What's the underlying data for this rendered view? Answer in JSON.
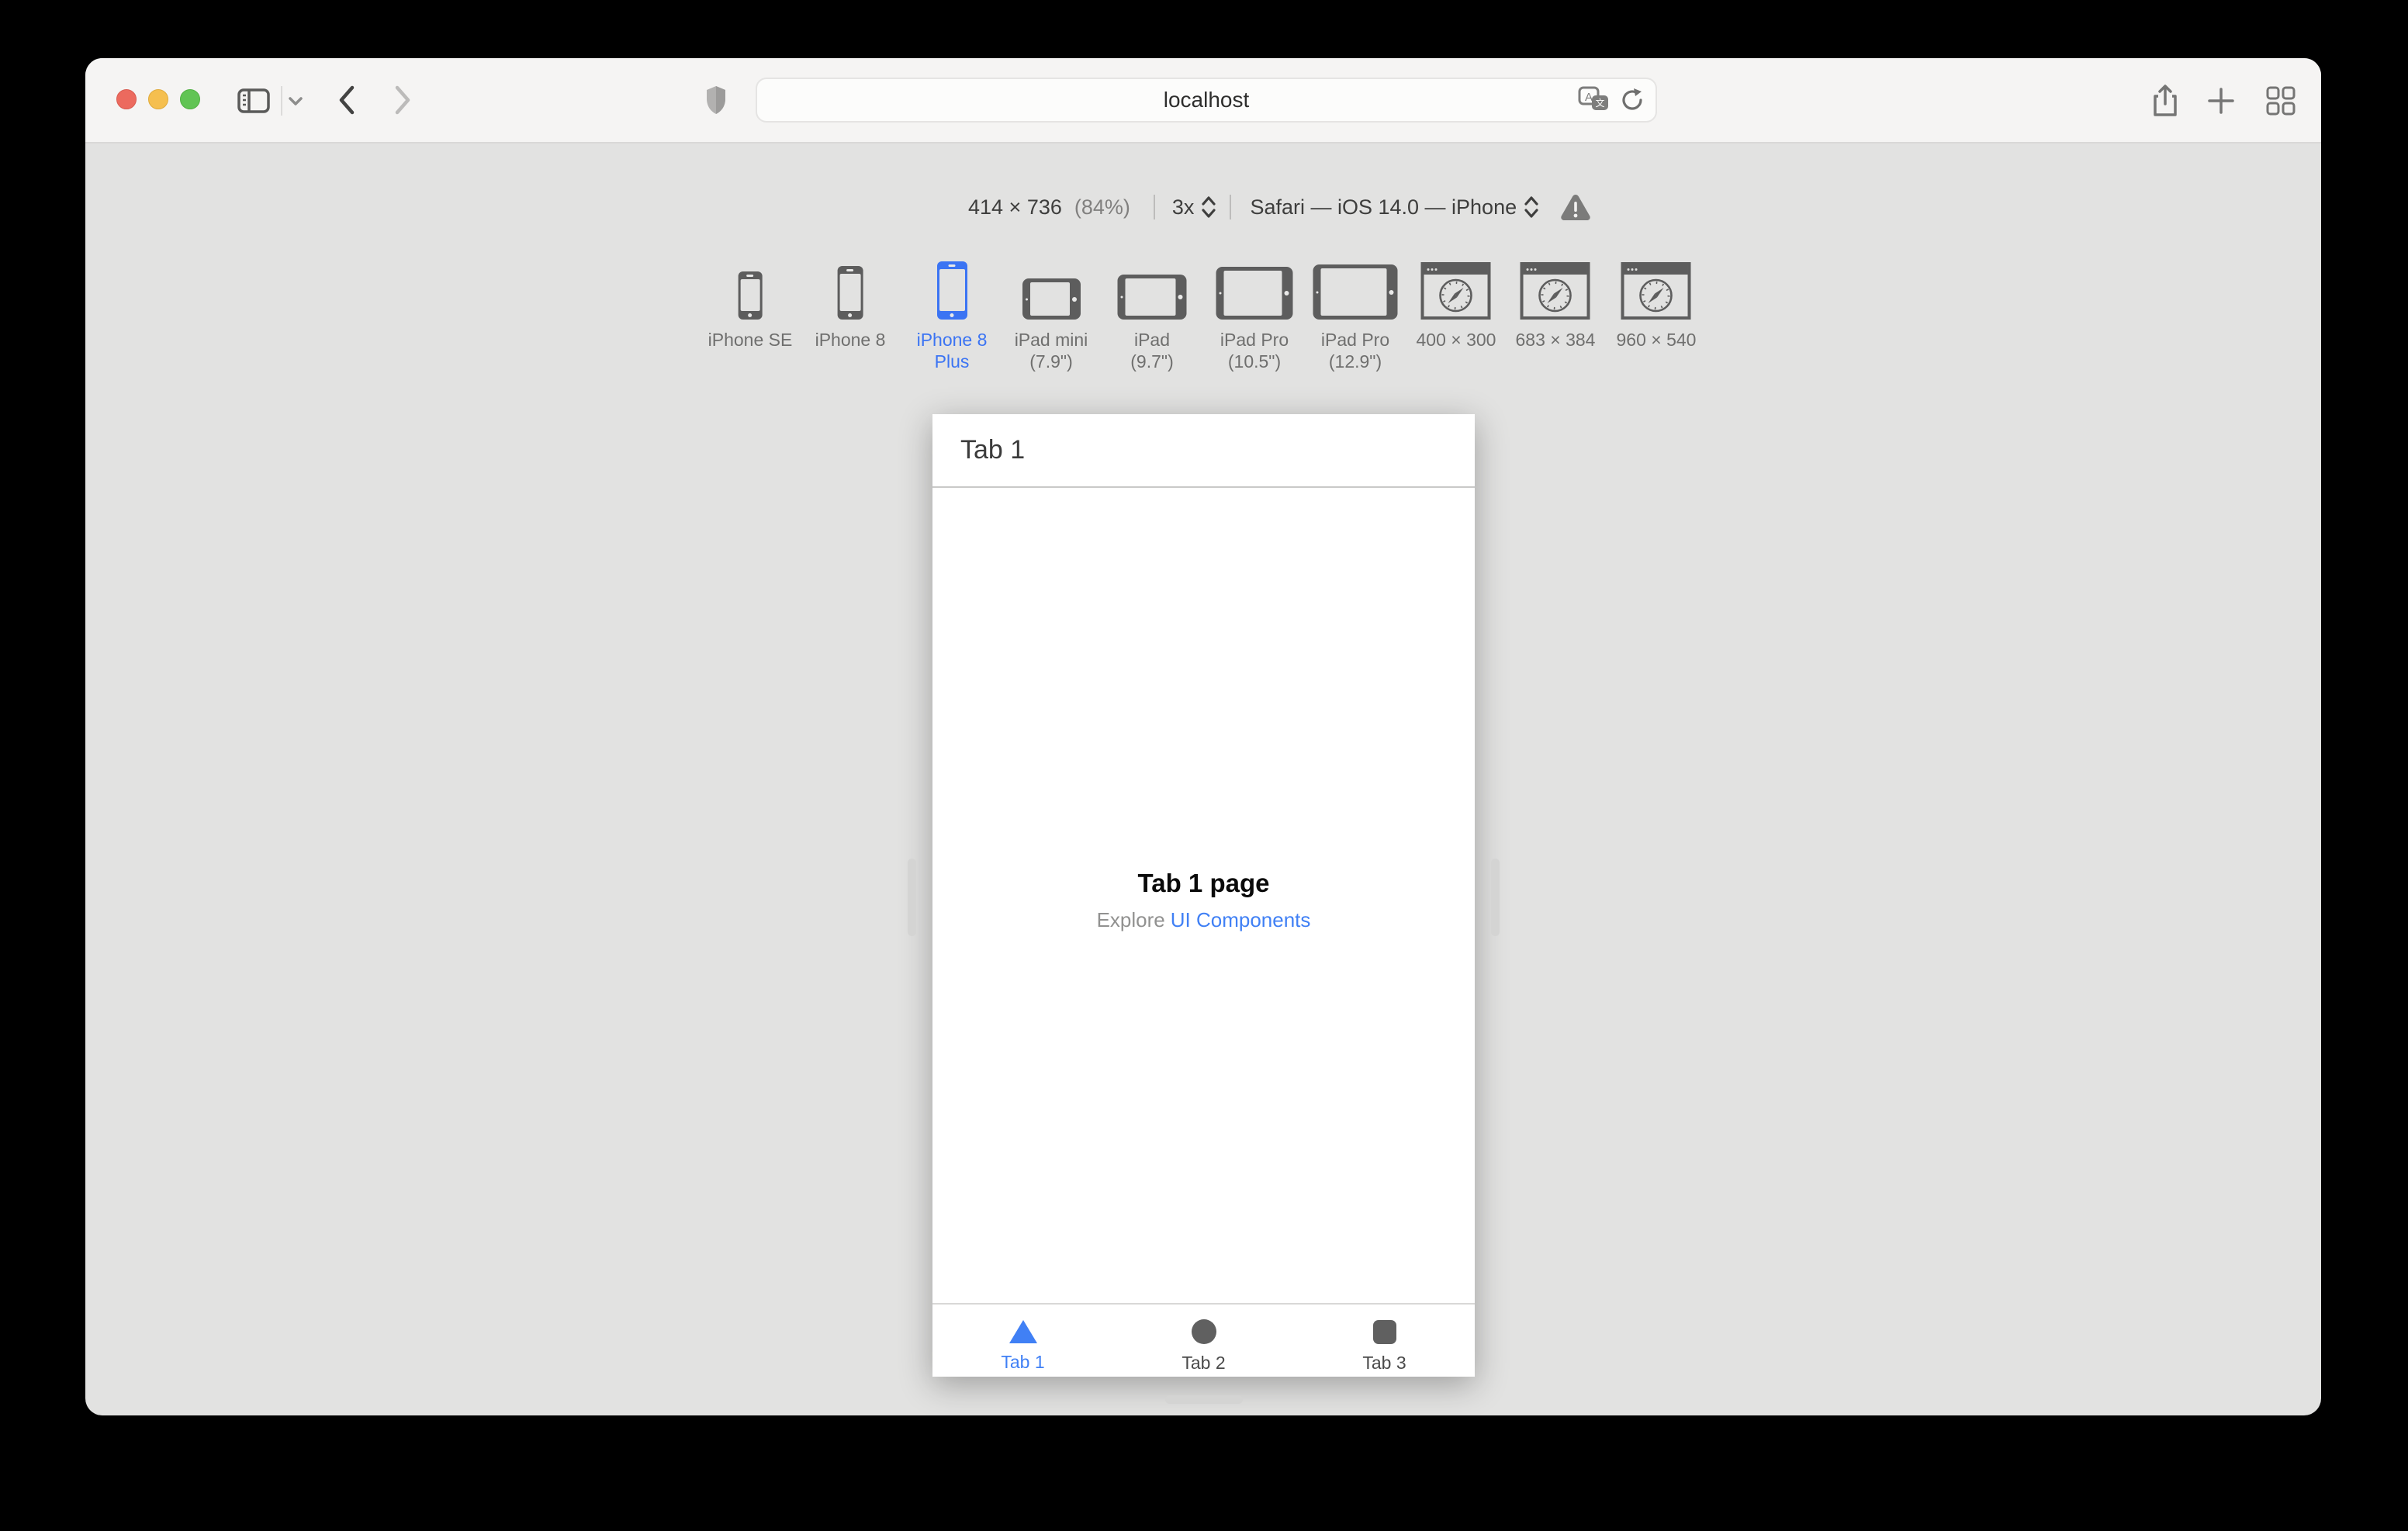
{
  "toolbar": {
    "url": "localhost",
    "icons": [
      "sidebar-icon",
      "chevron-down-icon",
      "back-icon",
      "forward-icon",
      "privacy-shield-icon",
      "translate-icon",
      "reload-icon",
      "share-icon",
      "new-tab-icon",
      "tab-overview-icon"
    ]
  },
  "rdm": {
    "size": "414 × 736",
    "zoom": "(84%)",
    "scale": "3x",
    "user_agent": "Safari — iOS 14.0 — iPhone",
    "devices": [
      {
        "label": "iPhone SE",
        "type": "phone",
        "selected": false
      },
      {
        "label": "iPhone 8",
        "type": "phone",
        "selected": false
      },
      {
        "label": "iPhone 8 Plus",
        "type": "phone",
        "selected": true
      },
      {
        "label": "iPad mini (7.9\")",
        "type": "tablet",
        "selected": false
      },
      {
        "label": "iPad (9.7\")",
        "type": "tablet",
        "selected": false
      },
      {
        "label": "iPad Pro (10.5\")",
        "type": "tablet",
        "selected": false
      },
      {
        "label": "iPad Pro (12.9\")",
        "type": "tablet",
        "selected": false
      },
      {
        "label": "400 × 300",
        "type": "window",
        "selected": false
      },
      {
        "label": "683 × 384",
        "type": "window",
        "selected": false
      },
      {
        "label": "960 × 540",
        "type": "window",
        "selected": false
      }
    ]
  },
  "app": {
    "nav_title": "Tab 1",
    "page_title": "Tab 1 page",
    "subtitle_prefix": "Explore",
    "subtitle_link": "UI Components",
    "tabs": [
      {
        "label": "Tab 1",
        "shape": "triangle",
        "active": true
      },
      {
        "label": "Tab 2",
        "shape": "circle",
        "active": false
      },
      {
        "label": "Tab 3",
        "shape": "square",
        "active": false
      }
    ]
  },
  "colors": {
    "accent": "#3b74f3",
    "link": "#4080f5",
    "frame_gray": "#5d5d5d",
    "background": "#e2e2e1"
  }
}
